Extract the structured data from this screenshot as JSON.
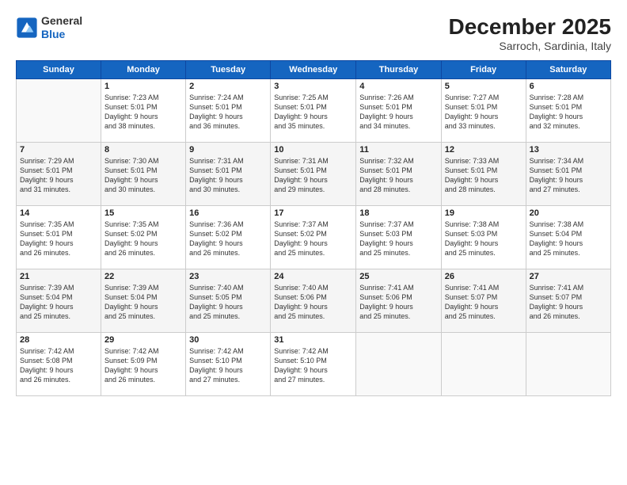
{
  "logo": {
    "general": "General",
    "blue": "Blue"
  },
  "title": {
    "month": "December 2025",
    "location": "Sarroch, Sardinia, Italy"
  },
  "headers": [
    "Sunday",
    "Monday",
    "Tuesday",
    "Wednesday",
    "Thursday",
    "Friday",
    "Saturday"
  ],
  "weeks": [
    [
      {
        "day": "",
        "info": ""
      },
      {
        "day": "1",
        "info": "Sunrise: 7:23 AM\nSunset: 5:01 PM\nDaylight: 9 hours\nand 38 minutes."
      },
      {
        "day": "2",
        "info": "Sunrise: 7:24 AM\nSunset: 5:01 PM\nDaylight: 9 hours\nand 36 minutes."
      },
      {
        "day": "3",
        "info": "Sunrise: 7:25 AM\nSunset: 5:01 PM\nDaylight: 9 hours\nand 35 minutes."
      },
      {
        "day": "4",
        "info": "Sunrise: 7:26 AM\nSunset: 5:01 PM\nDaylight: 9 hours\nand 34 minutes."
      },
      {
        "day": "5",
        "info": "Sunrise: 7:27 AM\nSunset: 5:01 PM\nDaylight: 9 hours\nand 33 minutes."
      },
      {
        "day": "6",
        "info": "Sunrise: 7:28 AM\nSunset: 5:01 PM\nDaylight: 9 hours\nand 32 minutes."
      }
    ],
    [
      {
        "day": "7",
        "info": "Sunrise: 7:29 AM\nSunset: 5:01 PM\nDaylight: 9 hours\nand 31 minutes."
      },
      {
        "day": "8",
        "info": "Sunrise: 7:30 AM\nSunset: 5:01 PM\nDaylight: 9 hours\nand 30 minutes."
      },
      {
        "day": "9",
        "info": "Sunrise: 7:31 AM\nSunset: 5:01 PM\nDaylight: 9 hours\nand 30 minutes."
      },
      {
        "day": "10",
        "info": "Sunrise: 7:31 AM\nSunset: 5:01 PM\nDaylight: 9 hours\nand 29 minutes."
      },
      {
        "day": "11",
        "info": "Sunrise: 7:32 AM\nSunset: 5:01 PM\nDaylight: 9 hours\nand 28 minutes."
      },
      {
        "day": "12",
        "info": "Sunrise: 7:33 AM\nSunset: 5:01 PM\nDaylight: 9 hours\nand 28 minutes."
      },
      {
        "day": "13",
        "info": "Sunrise: 7:34 AM\nSunset: 5:01 PM\nDaylight: 9 hours\nand 27 minutes."
      }
    ],
    [
      {
        "day": "14",
        "info": "Sunrise: 7:35 AM\nSunset: 5:01 PM\nDaylight: 9 hours\nand 26 minutes."
      },
      {
        "day": "15",
        "info": "Sunrise: 7:35 AM\nSunset: 5:02 PM\nDaylight: 9 hours\nand 26 minutes."
      },
      {
        "day": "16",
        "info": "Sunrise: 7:36 AM\nSunset: 5:02 PM\nDaylight: 9 hours\nand 26 minutes."
      },
      {
        "day": "17",
        "info": "Sunrise: 7:37 AM\nSunset: 5:02 PM\nDaylight: 9 hours\nand 25 minutes."
      },
      {
        "day": "18",
        "info": "Sunrise: 7:37 AM\nSunset: 5:03 PM\nDaylight: 9 hours\nand 25 minutes."
      },
      {
        "day": "19",
        "info": "Sunrise: 7:38 AM\nSunset: 5:03 PM\nDaylight: 9 hours\nand 25 minutes."
      },
      {
        "day": "20",
        "info": "Sunrise: 7:38 AM\nSunset: 5:04 PM\nDaylight: 9 hours\nand 25 minutes."
      }
    ],
    [
      {
        "day": "21",
        "info": "Sunrise: 7:39 AM\nSunset: 5:04 PM\nDaylight: 9 hours\nand 25 minutes."
      },
      {
        "day": "22",
        "info": "Sunrise: 7:39 AM\nSunset: 5:04 PM\nDaylight: 9 hours\nand 25 minutes."
      },
      {
        "day": "23",
        "info": "Sunrise: 7:40 AM\nSunset: 5:05 PM\nDaylight: 9 hours\nand 25 minutes."
      },
      {
        "day": "24",
        "info": "Sunrise: 7:40 AM\nSunset: 5:06 PM\nDaylight: 9 hours\nand 25 minutes."
      },
      {
        "day": "25",
        "info": "Sunrise: 7:41 AM\nSunset: 5:06 PM\nDaylight: 9 hours\nand 25 minutes."
      },
      {
        "day": "26",
        "info": "Sunrise: 7:41 AM\nSunset: 5:07 PM\nDaylight: 9 hours\nand 25 minutes."
      },
      {
        "day": "27",
        "info": "Sunrise: 7:41 AM\nSunset: 5:07 PM\nDaylight: 9 hours\nand 26 minutes."
      }
    ],
    [
      {
        "day": "28",
        "info": "Sunrise: 7:42 AM\nSunset: 5:08 PM\nDaylight: 9 hours\nand 26 minutes."
      },
      {
        "day": "29",
        "info": "Sunrise: 7:42 AM\nSunset: 5:09 PM\nDaylight: 9 hours\nand 26 minutes."
      },
      {
        "day": "30",
        "info": "Sunrise: 7:42 AM\nSunset: 5:10 PM\nDaylight: 9 hours\nand 27 minutes."
      },
      {
        "day": "31",
        "info": "Sunrise: 7:42 AM\nSunset: 5:10 PM\nDaylight: 9 hours\nand 27 minutes."
      },
      {
        "day": "",
        "info": ""
      },
      {
        "day": "",
        "info": ""
      },
      {
        "day": "",
        "info": ""
      }
    ]
  ]
}
